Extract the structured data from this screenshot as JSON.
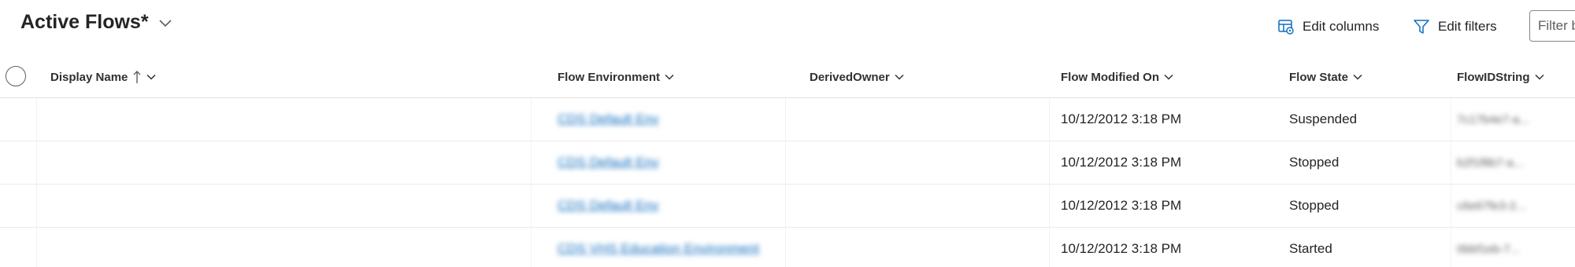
{
  "view": {
    "title": "Active Flows*"
  },
  "commands": {
    "edit_columns": "Edit columns",
    "edit_filters": "Edit filters",
    "filter_placeholder": "Filter by keyword"
  },
  "columns": {
    "display_name": "Display Name",
    "flow_environment": "Flow Environment",
    "derived_owner": "DerivedOwner",
    "flow_modified_on": "Flow Modified On",
    "flow_state": "Flow State",
    "flow_id_string": "FlowIDString"
  },
  "sort": {
    "column": "display_name",
    "direction": "ascending"
  },
  "rows": [
    {
      "display_name": "",
      "flow_environment": "CDS Default Env",
      "derived_owner": "",
      "flow_modified_on": "10/12/2012 3:18 PM",
      "flow_state": "Suspended",
      "flow_id_string": "7c17b4e7-a..."
    },
    {
      "display_name": "",
      "flow_environment": "CDS Default Env",
      "derived_owner": "",
      "flow_modified_on": "10/12/2012 3:18 PM",
      "flow_state": "Stopped",
      "flow_id_string": "b2f1f8b7-a..."
    },
    {
      "display_name": "",
      "flow_environment": "CDS Default Env",
      "derived_owner": "",
      "flow_modified_on": "10/12/2012 3:18 PM",
      "flow_state": "Stopped",
      "flow_id_string": "c6e67fe3-2..."
    },
    {
      "display_name": "",
      "flow_environment": "CDS VHS Education Environment",
      "derived_owner": "",
      "flow_modified_on": "10/12/2012 3:18 PM",
      "flow_state": "Started",
      "flow_id_string": "0bbf1eb-7..."
    }
  ],
  "colors": {
    "text": "#242424",
    "link": "#0f6cbd",
    "border": "#e1dfdd",
    "icon": "#0f6cbd"
  }
}
